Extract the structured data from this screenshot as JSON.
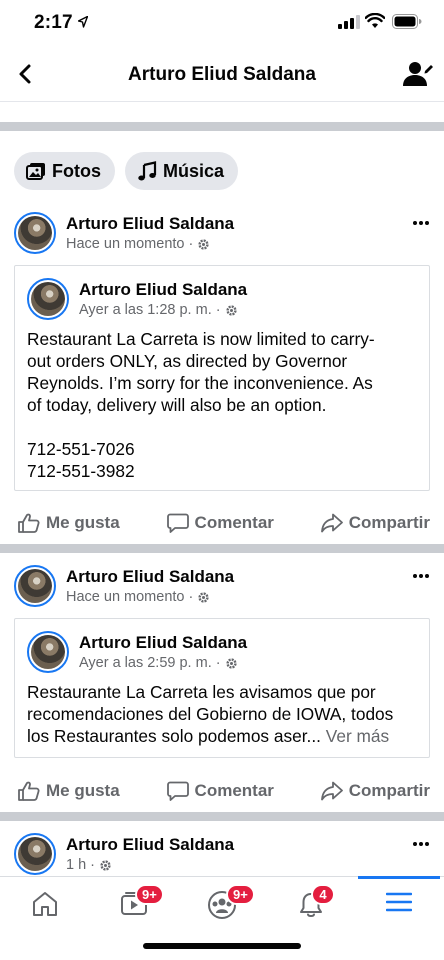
{
  "status": {
    "time": "2:17"
  },
  "nav": {
    "title": "Arturo Eliud Saldana"
  },
  "chips": [
    {
      "label": "Fotos",
      "icon": "photos-icon"
    },
    {
      "label": "Música",
      "icon": "music-icon"
    }
  ],
  "posts": [
    {
      "author": "Arturo Eliud Saldana",
      "time": "Hace un momento",
      "shared": {
        "author": "Arturo Eliud Saldana",
        "time": "Ayer a las 1:28 p. m.",
        "text_lines": [
          "Restaurant La Carreta is now limited to carry-",
          "out orders ONLY, as directed by Governor",
          "Reynolds. I’m sorry for the inconvenience. As",
          "of today, delivery will also be an option.",
          "",
          "712-551-7026",
          "712-551-3982"
        ]
      },
      "actions": {
        "like": "Me gusta",
        "comment": "Comentar",
        "share": "Compartir"
      }
    },
    {
      "author": "Arturo Eliud Saldana",
      "time": "Hace un momento",
      "shared": {
        "author": "Arturo Eliud Saldana",
        "time": "Ayer a las 2:59 p. m.",
        "text_lines": [
          "Restaurante La Carreta les avisamos que por",
          "recomendaciones del Gobierno de IOWA, todos",
          "los Restaurantes solo podemos aser..."
        ],
        "see_more": "Ver más"
      },
      "actions": {
        "like": "Me gusta",
        "comment": "Comentar",
        "share": "Compartir"
      }
    },
    {
      "author": "Arturo Eliud Saldana",
      "time": "1 h"
    }
  ],
  "tabbar": {
    "watch_badge": "9+",
    "groups_badge": "9+",
    "notifications_badge": "4"
  },
  "colors": {
    "accent": "#1877f2",
    "badge": "#e41e3f",
    "muted": "#65676b"
  }
}
